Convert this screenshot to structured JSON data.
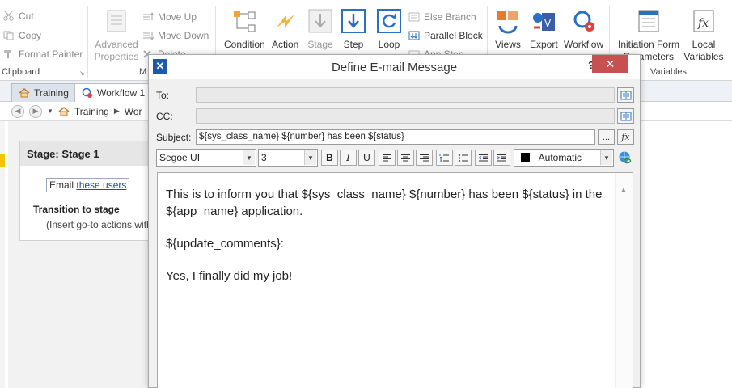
{
  "ribbon": {
    "clipboard": {
      "cut": "Cut",
      "copy": "Copy",
      "format_painter": "Format Painter",
      "group_label": "Clipboard"
    },
    "advanced_properties": "Advanced Properties",
    "move": {
      "up": "Move Up",
      "down": "Move Down",
      "delete": "Delete",
      "group_label_partial": "M"
    },
    "actions": {
      "condition": "Condition",
      "action": "Action",
      "stage": "Stage",
      "step": "Step",
      "loop": "Loop"
    },
    "branches": {
      "else_branch": "Else Branch",
      "parallel_block": "Parallel Block",
      "app_step": "App Step"
    },
    "views": "Views",
    "export": "Export",
    "workflow": "Workflow",
    "initiation_form": "Initiation Form Parameters",
    "local_variables": "Local Variables",
    "variables_group_label": "Variables"
  },
  "tabs": [
    {
      "label": "Training",
      "icon": "home-icon"
    },
    {
      "label": "Workflow 1",
      "icon": "workflow-icon"
    }
  ],
  "breadcrumb": {
    "item1": "Training",
    "item2": "Wor"
  },
  "stage": {
    "title": "Stage: Stage 1",
    "email_prefix": "Email",
    "email_link": "these users",
    "transition_heading": "Transition to stage",
    "insert_text": "(Insert go-to actions with conditions)"
  },
  "dialog": {
    "title": "Define E-mail Message",
    "help": "?",
    "to_label": "To:",
    "to_value": "",
    "cc_label": "CC:",
    "cc_value": "",
    "subject_label": "Subject:",
    "subject_value": "${sys_class_name} ${number} has been ${status}",
    "ellipsis": "...",
    "fx": "fx",
    "font": "Segoe UI",
    "size": "3",
    "color": "Automatic",
    "body": [
      "This is to inform you that ${sys_class_name} ${number} has been ${status} in the ${app_name} application.",
      "${update_comments}:",
      "Yes, I finally did my job!"
    ]
  },
  "colors": {
    "accent": "#1e5aa8",
    "close": "#c75050",
    "link": "#1f4e9c"
  }
}
